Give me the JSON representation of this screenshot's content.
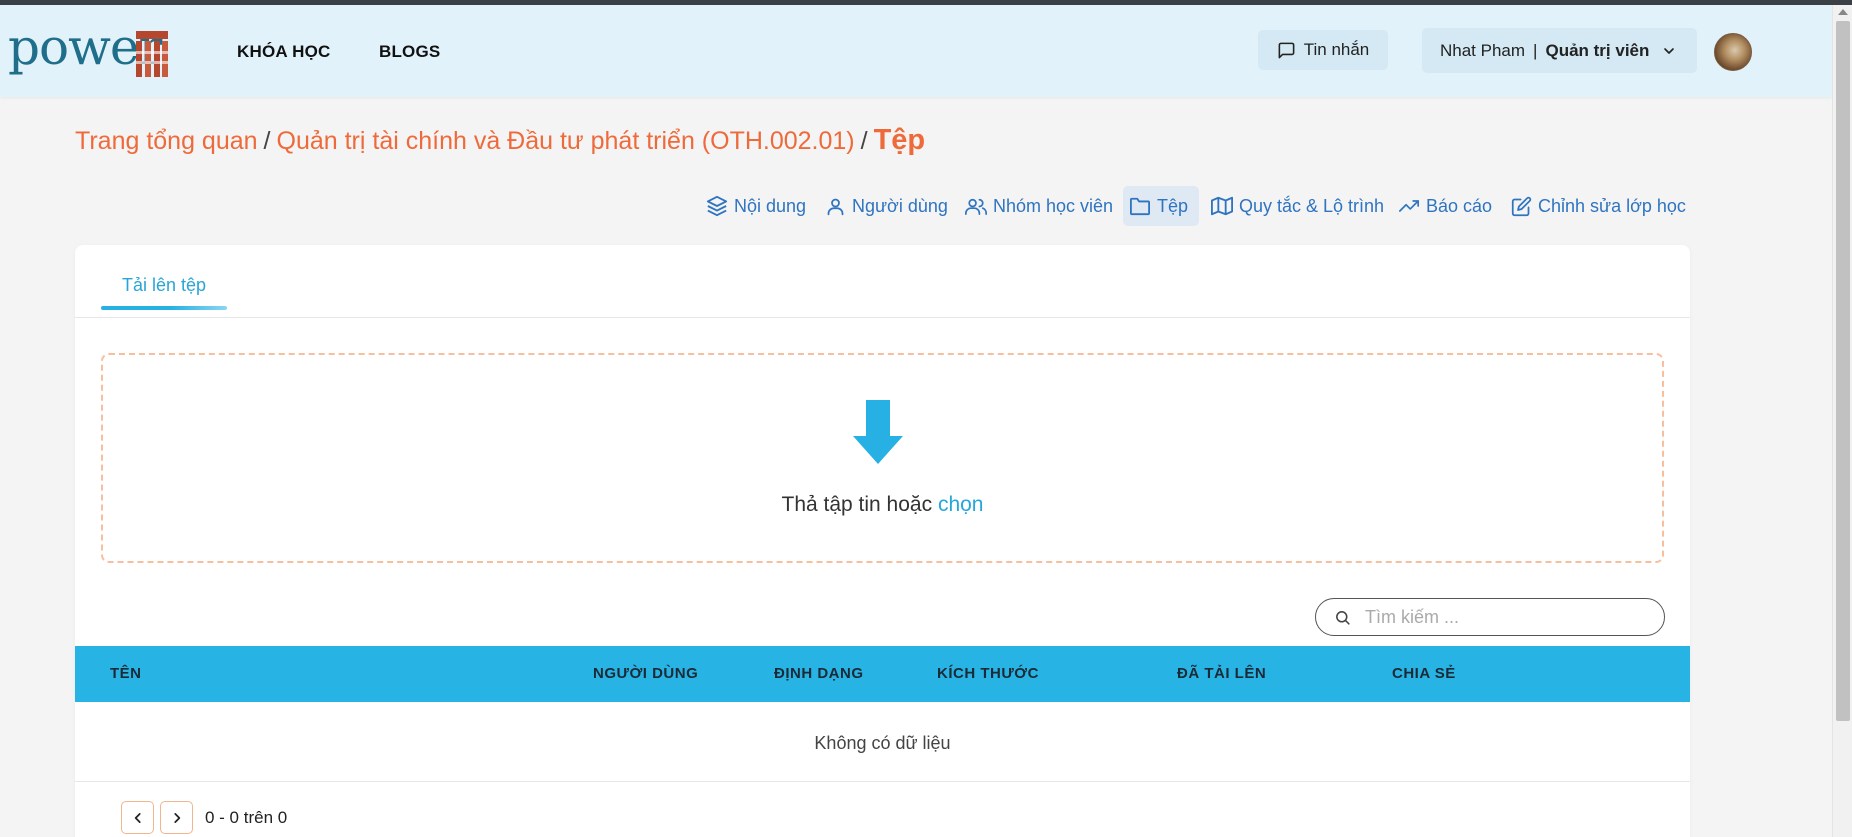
{
  "header": {
    "logo_text": "power",
    "nav": [
      {
        "label": "KHÓA HỌC"
      },
      {
        "label": "BLOGS"
      }
    ],
    "messages_label": "Tin nhắn",
    "user_name": "Nhat Pham",
    "user_separator": "|",
    "user_role": "Quản trị viên"
  },
  "breadcrumb": {
    "items": [
      "Trang tổng quan",
      "Quản trị tài chính và Đầu tư phát triển (OTH.002.01)"
    ],
    "separator": "/",
    "current": "Tệp"
  },
  "actions": [
    {
      "label": "Nội dung",
      "icon": "layers-icon"
    },
    {
      "label": "Người dùng",
      "icon": "user-icon"
    },
    {
      "label": "Nhóm học viên",
      "icon": "users-icon"
    },
    {
      "label": "Tệp",
      "icon": "folder-icon",
      "active": true
    },
    {
      "label": "Quy tắc & Lộ trình",
      "icon": "map-icon"
    },
    {
      "label": "Báo cáo",
      "icon": "trending-up-icon"
    },
    {
      "label": "Chỉnh sửa lớp học",
      "icon": "edit-icon"
    }
  ],
  "card": {
    "tab_label": "Tải lên tệp",
    "dropzone": {
      "text": "Thả tập tin hoặc",
      "link": "chọn"
    },
    "search": {
      "placeholder": "Tìm kiếm ...",
      "value": ""
    },
    "table": {
      "columns": [
        "TÊN",
        "NGƯỜI DÙNG",
        "ĐỊNH DẠNG",
        "KÍCH THƯỚC",
        "ĐÃ TẢI LÊN",
        "CHIA SẺ"
      ],
      "rows": [],
      "empty_text": "Không có dữ liệu"
    },
    "pagination": {
      "info": "0 - 0 trên 0"
    }
  },
  "colors": {
    "header_bg": "#e2f2fa",
    "accent_orange": "#ef6a3a",
    "link_blue": "#2f74c0",
    "table_header_bg": "#27b4e4",
    "dropzone_border": "#f7bf9e"
  }
}
